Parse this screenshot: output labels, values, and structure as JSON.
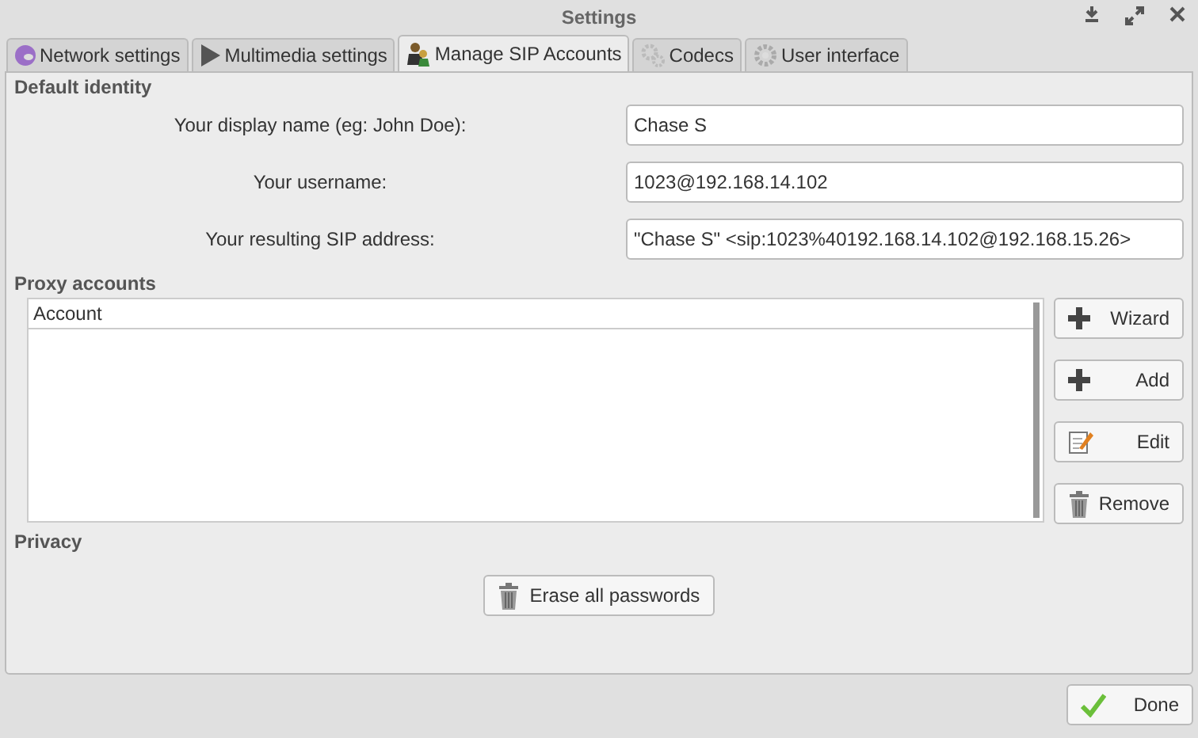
{
  "window": {
    "title": "Settings"
  },
  "tabs": [
    {
      "label": "Network settings",
      "selected": false
    },
    {
      "label": "Multimedia settings",
      "selected": false
    },
    {
      "label": "Manage SIP Accounts",
      "selected": true
    },
    {
      "label": "Codecs",
      "selected": false
    },
    {
      "label": "User interface",
      "selected": false
    }
  ],
  "default_identity": {
    "heading": "Default identity",
    "fields": [
      {
        "label": "Your display name (eg: John Doe):",
        "value": "Chase S"
      },
      {
        "label": "Your username:",
        "value": "1023@192.168.14.102"
      },
      {
        "label": "Your resulting SIP address:",
        "value": "\"Chase S\" <sip:1023%40192.168.14.102@192.168.15.26>"
      }
    ]
  },
  "proxy_accounts": {
    "heading": "Proxy accounts",
    "table": {
      "columns": [
        "Account"
      ]
    },
    "buttons": [
      "Wizard",
      "Add",
      "Edit",
      "Remove"
    ]
  },
  "privacy": {
    "heading": "Privacy",
    "button": "Erase all passwords"
  },
  "footer": {
    "button": "Done"
  }
}
